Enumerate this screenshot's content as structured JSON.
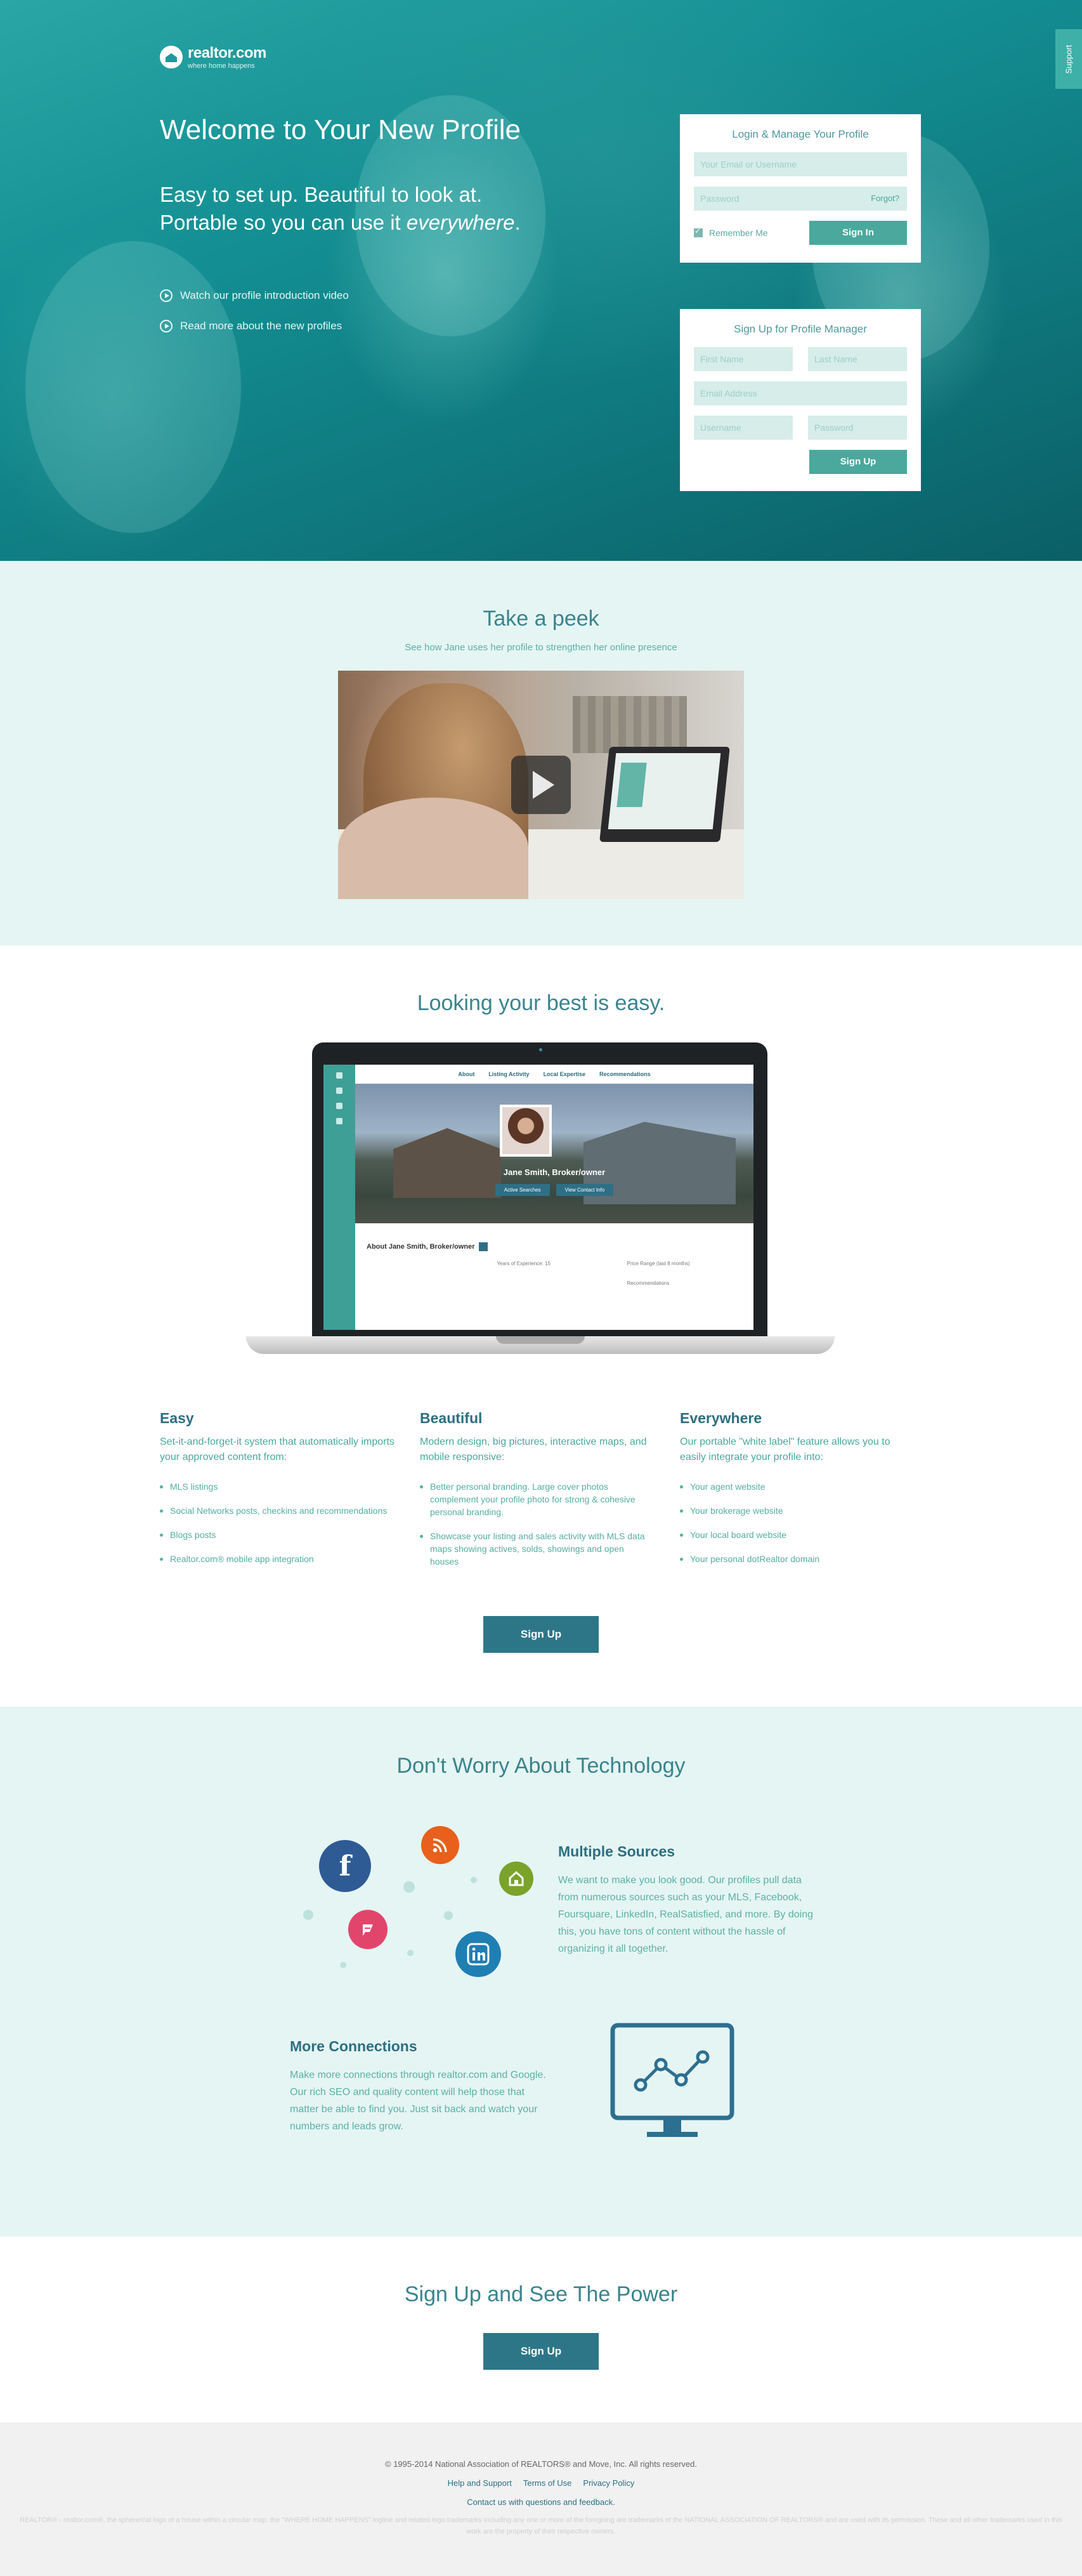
{
  "hero": {
    "logo_brand": "realtor.com",
    "logo_tagline": "where home happens",
    "title": "Welcome to Your New Profile",
    "subtitle_pre": "Easy to set up. Beautiful to look at. Portable so you can use it ",
    "subtitle_em": "everywhere",
    "subtitle_post": ".",
    "links": [
      "Watch our profile introduction video",
      "Read more about the new profiles"
    ],
    "support_label": "Support"
  },
  "login": {
    "title": "Login & Manage Your Profile",
    "email_placeholder": "Your Email or Username",
    "password_placeholder": "Password",
    "forgot": "Forgot?",
    "remember": "Remember Me",
    "signin": "Sign In"
  },
  "signup": {
    "title": "Sign Up for Profile Manager",
    "first_name": "First Name",
    "last_name": "Last Name",
    "email": "Email Address",
    "username": "Username",
    "password": "Password",
    "button": "Sign Up"
  },
  "peek": {
    "title": "Take a peek",
    "tagline": "See how Jane uses her profile to strengthen her online presence"
  },
  "looking": {
    "title": "Looking your best is easy.",
    "mock": {
      "nav": [
        "About",
        "Listing Activity",
        "Local Expertise",
        "Recommendations"
      ],
      "name": "Jane Smith, Broker/owner",
      "btn1": "Active Searches",
      "btn2": "View Contact Info",
      "about": "About Jane Smith, Broker/owner",
      "years": "Years of Experience: 15",
      "price": "Price Range (last 8 months)",
      "recs": "Recommendations"
    },
    "features": [
      {
        "title": "Easy",
        "lead": "Set-it-and-forget-it system that automatically imports your approved content from:",
        "items": [
          "MLS listings",
          "Social Networks posts, checkins and recommendations",
          "Blogs posts",
          "Realtor.com® mobile app integration"
        ]
      },
      {
        "title": "Beautiful",
        "lead": "Modern design, big pictures, interactive maps, and mobile responsive:",
        "items": [
          "Better personal branding. Large cover photos complement your profile photo for strong & cohesive personal branding.",
          "Showcase your listing and sales activity with MLS data maps showing actives, solds, showings and open houses"
        ]
      },
      {
        "title": "Everywhere",
        "lead": "Our portable \"white label\" feature allows you to easily integrate your profile into:",
        "items": [
          "Your agent website",
          "Your brokerage website",
          "Your local board website",
          "Your personal dotRealtor domain"
        ]
      }
    ],
    "signup_button": "Sign Up"
  },
  "tech": {
    "title": "Don't Worry About Technology",
    "sources_title": "Multiple Sources",
    "sources_text": "We want to make you look good. Our profiles pull data from numerous sources such as your MLS, Facebook, Foursquare, LinkedIn, RealSatisfied, and more. By doing this, you have tons of content without the hassle of organizing it all together.",
    "connections_title": "More Connections",
    "connections_text": "Make more connections through realtor.com and Google. Our rich SEO and quality content will help those that matter be able to find you. Just sit back and watch your numbers and leads grow.",
    "icons": {
      "facebook": "#2f5b95",
      "rss": "#e8601b",
      "home": "#7aa32a",
      "foursquare": "#e2456c",
      "linkedin": "#1f7fb3"
    }
  },
  "power": {
    "title": "Sign Up and See The Power",
    "button": "Sign Up"
  },
  "footer": {
    "copyright": "© 1995-2014 National Association of REALTORS® and Move, Inc. All rights reserved.",
    "links": [
      "Help and Support",
      "Terms of Use",
      "Privacy Policy"
    ],
    "contact": "Contact us with questions and feedback.",
    "legal": "REALTOR® - realtor.com®, the sphere/cat logo of a house within a circular map, the \"WHERE HOME HAPPENS\" logline and related logo trademarks including any one or more of the foregoing are trademarks of the NATIONAL ASSOCIATION OF REALTORS® and are used with its permission. These and all other trademarks used in this work are the property of their respective owners."
  },
  "colors": {
    "teal_dark": "#2d7688",
    "teal_btn": "#4aa89c",
    "mint_bg": "#e5f5f3"
  }
}
